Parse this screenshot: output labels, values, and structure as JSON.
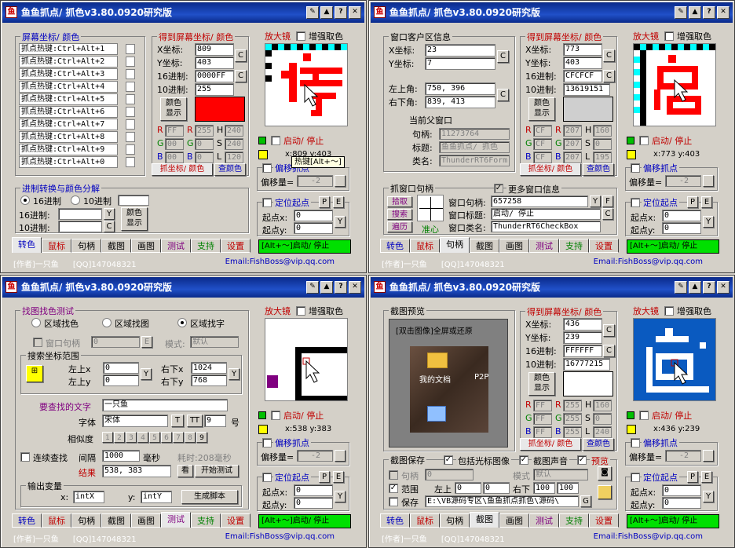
{
  "app_title": "鱼鱼抓点/ 抓色v3.80.0920研究版",
  "title_buttons": [
    "✎",
    "▲",
    "?",
    "✕"
  ],
  "tabs": [
    "转色",
    "鼠标",
    "句柄",
    "截图",
    "画图",
    "测试",
    "支持",
    "设置"
  ],
  "tab_colors": [
    "#0000c0",
    "#c00000",
    "#000000",
    "#000000",
    "#000000",
    "#800080",
    "#008000",
    "#c00000"
  ],
  "author": "[作者]一只鱼",
  "qq": "[QQ]147048321",
  "email": "Email:FishBoss@vip.qq.com",
  "mag": {
    "title": "放大镜",
    "enhance": "增强取色",
    "start": "启动/ 停止",
    "offset_label": "偏移抓点",
    "offset_amount_label": "偏移量=",
    "offset_value": "-2",
    "locate_label": "定位起点",
    "btn_p": "P",
    "btn_e": "E",
    "startx_label": "起点x:",
    "starty_label": "起点y:",
    "startx": "0",
    "starty": "0",
    "btn_y": "Y",
    "hotbar": "[Alt+～]启动/ 停止"
  },
  "w1": {
    "group1_title": "屏幕坐标/ 颜色",
    "hotkeys": [
      "抓点热键:Ctrl+Alt+1",
      "抓点热键:Ctrl+Alt+2",
      "抓点热键:Ctrl+Alt+3",
      "抓点热键:Ctrl+Alt+4",
      "抓点热键:Ctrl+Alt+5",
      "抓点热键:Ctrl+Alt+6",
      "抓点热键:Ctrl+Alt+7",
      "抓点热键:Ctrl+Alt+8",
      "抓点热键:Ctrl+Alt+9",
      "抓点热键:Ctrl+Alt+0"
    ],
    "group2_title": "得到屏幕坐标/ 颜色",
    "x_label": "X坐标:",
    "x": "809",
    "y_label": "Y坐标:",
    "y": "403",
    "hex_label": "16进制:",
    "hex": "0000FF",
    "dec_label": "10进制:",
    "dec": "255",
    "color_show": "颜色\n显示",
    "swatch": "#ff0000",
    "rgb": {
      "r": "FF",
      "g": "00",
      "b": "00",
      "r2": "255",
      "g2": "0",
      "b2": "0",
      "h": "240",
      "s": "240",
      "l": "120"
    },
    "subtab_a": "抓坐标/ 颜色",
    "subtab_b": "查颜色",
    "group3_title": "进制转换与颜色分解",
    "hex16": "16进制",
    "hex10": "10进制",
    "in16": "16进制:",
    "in10": "10进制:",
    "colorshow2": "颜色\n显示",
    "tooltip": "热键[Alt+～]",
    "coords": "x:809 y:403"
  },
  "w2": {
    "group1_title": "窗口客户区信息",
    "x_label": "X坐标:",
    "x": "23",
    "y_label": "Y坐标:",
    "y": "7",
    "lt_label": "左上角:",
    "lt": "750, 396",
    "rb_label": "右下角:",
    "rb": "839, 413",
    "parent_title": "当前父窗口",
    "h_label": "句柄:",
    "h": "11273764",
    "t_label": "标题:",
    "t": "鱼鱼抓点/ 抓色",
    "c_label": "类名:",
    "c": "ThunderRT6Form",
    "group2_title": "得到屏幕坐标/ 颜色",
    "sx": "773",
    "sy": "403",
    "hex": "CFCFCF",
    "dec": "13619151",
    "swatch": "#cfcfcf",
    "rgb": {
      "r": "CF",
      "g": "CF",
      "b": "CF",
      "r2": "207",
      "g2": "207",
      "b2": "207",
      "h": "160",
      "s": "0",
      "l": "195"
    },
    "coords": "x:773 y:403",
    "grab_title": "抓窗口句柄",
    "more_info": "更多窗口信息",
    "pick": "拾取",
    "search": "搜索",
    "traverse": "遍历",
    "crosshair": "准心",
    "wh_label": "窗口句柄:",
    "wh": "657258",
    "wt_label": "窗口标题:",
    "wt": "启动/ 停止",
    "wc_label": "窗口类名:",
    "wc": "ThunderRT6CheckBox",
    "btn_f": "F"
  },
  "w3": {
    "group_title": "找图找色测试",
    "opts": [
      "区域找色",
      "区域找图",
      "区域找字"
    ],
    "wh_label": "窗口句柄",
    "wh": "0",
    "mode_label": "模式:",
    "mode": "默认",
    "range_title": "搜索坐标范围",
    "ltx": "左上x",
    "lty": "左上y",
    "ltxv": "0",
    "ltyv": "0",
    "rbx": "右下x",
    "rby": "右下y",
    "rbxv": "1024",
    "rbyv": "768",
    "text_label": "要查找的文字",
    "text": "一只鱼",
    "font_label": "字体",
    "font": "宋体",
    "size": "9",
    "size_unit": "号",
    "sim_label": "相似度",
    "sim": [
      "1",
      "2",
      "3",
      "4",
      "5",
      "6",
      "7",
      "8",
      "9"
    ],
    "cont": "连续查找",
    "interval_label": "间隔",
    "interval": "1000",
    "ms": "毫秒",
    "elapsed": "耗时:208毫秒",
    "result_label": "结果",
    "result": "538, 383",
    "look": "看",
    "test": "开始测试",
    "out_title": "输出变量",
    "xv_label": "x:",
    "xv": "intX",
    "yv_label": "y:",
    "yv": "intY",
    "gen": "生成脚本",
    "coords": "x:538 y:383"
  },
  "w4": {
    "preview_title": "截图预览",
    "hint": "[双击图像]全屏或还原",
    "icon_label": "我的文档",
    "icon2": "P2P",
    "group2_title": "得到屏幕坐标/ 颜色",
    "sx": "436",
    "sy": "239",
    "hex": "FFFFFF",
    "dec": "16777215",
    "swatch": "#ffffff",
    "rgb": {
      "r": "FF",
      "g": "FF",
      "b": "FF",
      "r2": "255",
      "g2": "255",
      "b2": "255",
      "h": "160",
      "s": "0",
      "l": "240"
    },
    "save_title": "截图保存",
    "cursor": "包括光标图像",
    "sound": "截图声音",
    "preview": "预览",
    "h_label": "句柄",
    "h": "0",
    "mode_label": "模式",
    "mode": "默认",
    "range_label": "范围",
    "lt": "左上",
    "ltx": "0",
    "lty": "0",
    "rb": "右下",
    "rbx": "100",
    "rby": "100",
    "save_label": "保存",
    "path": "E:\\VB源码专区\\鱼鱼抓点抓色\\源码\\",
    "coords": "x:436 y:239"
  }
}
